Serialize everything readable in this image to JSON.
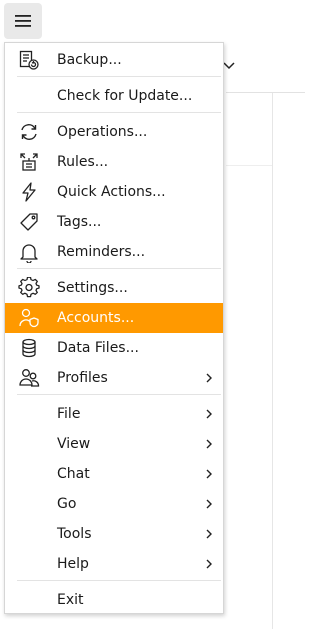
{
  "accent_color": "#ff9900",
  "toolbar": {
    "menu_button_icon": "hamburger-icon",
    "background_chevron_icon": "chevron-down-icon"
  },
  "menu": {
    "items": [
      {
        "label": "Backup...",
        "icon": "backup-icon"
      },
      {
        "label": "Check for Update...",
        "icon": ""
      },
      {
        "label": "Operations...",
        "icon": "refresh-icon"
      },
      {
        "label": "Rules...",
        "icon": "rules-icon"
      },
      {
        "label": "Quick Actions...",
        "icon": "lightning-icon"
      },
      {
        "label": "Tags...",
        "icon": "tag-icon"
      },
      {
        "label": "Reminders...",
        "icon": "bell-icon"
      },
      {
        "label": "Settings...",
        "icon": "gear-icon"
      },
      {
        "label": "Accounts...",
        "icon": "user-shield-icon",
        "selected": true
      },
      {
        "label": "Data Files...",
        "icon": "database-icon"
      },
      {
        "label": "Profiles",
        "icon": "profiles-icon",
        "submenu": true
      },
      {
        "label": "File",
        "icon": "",
        "submenu": true
      },
      {
        "label": "View",
        "icon": "",
        "submenu": true
      },
      {
        "label": "Chat",
        "icon": "",
        "submenu": true
      },
      {
        "label": "Go",
        "icon": "",
        "submenu": true
      },
      {
        "label": "Tools",
        "icon": "",
        "submenu": true
      },
      {
        "label": "Help",
        "icon": "",
        "submenu": true
      },
      {
        "label": "Exit",
        "icon": ""
      }
    ]
  }
}
